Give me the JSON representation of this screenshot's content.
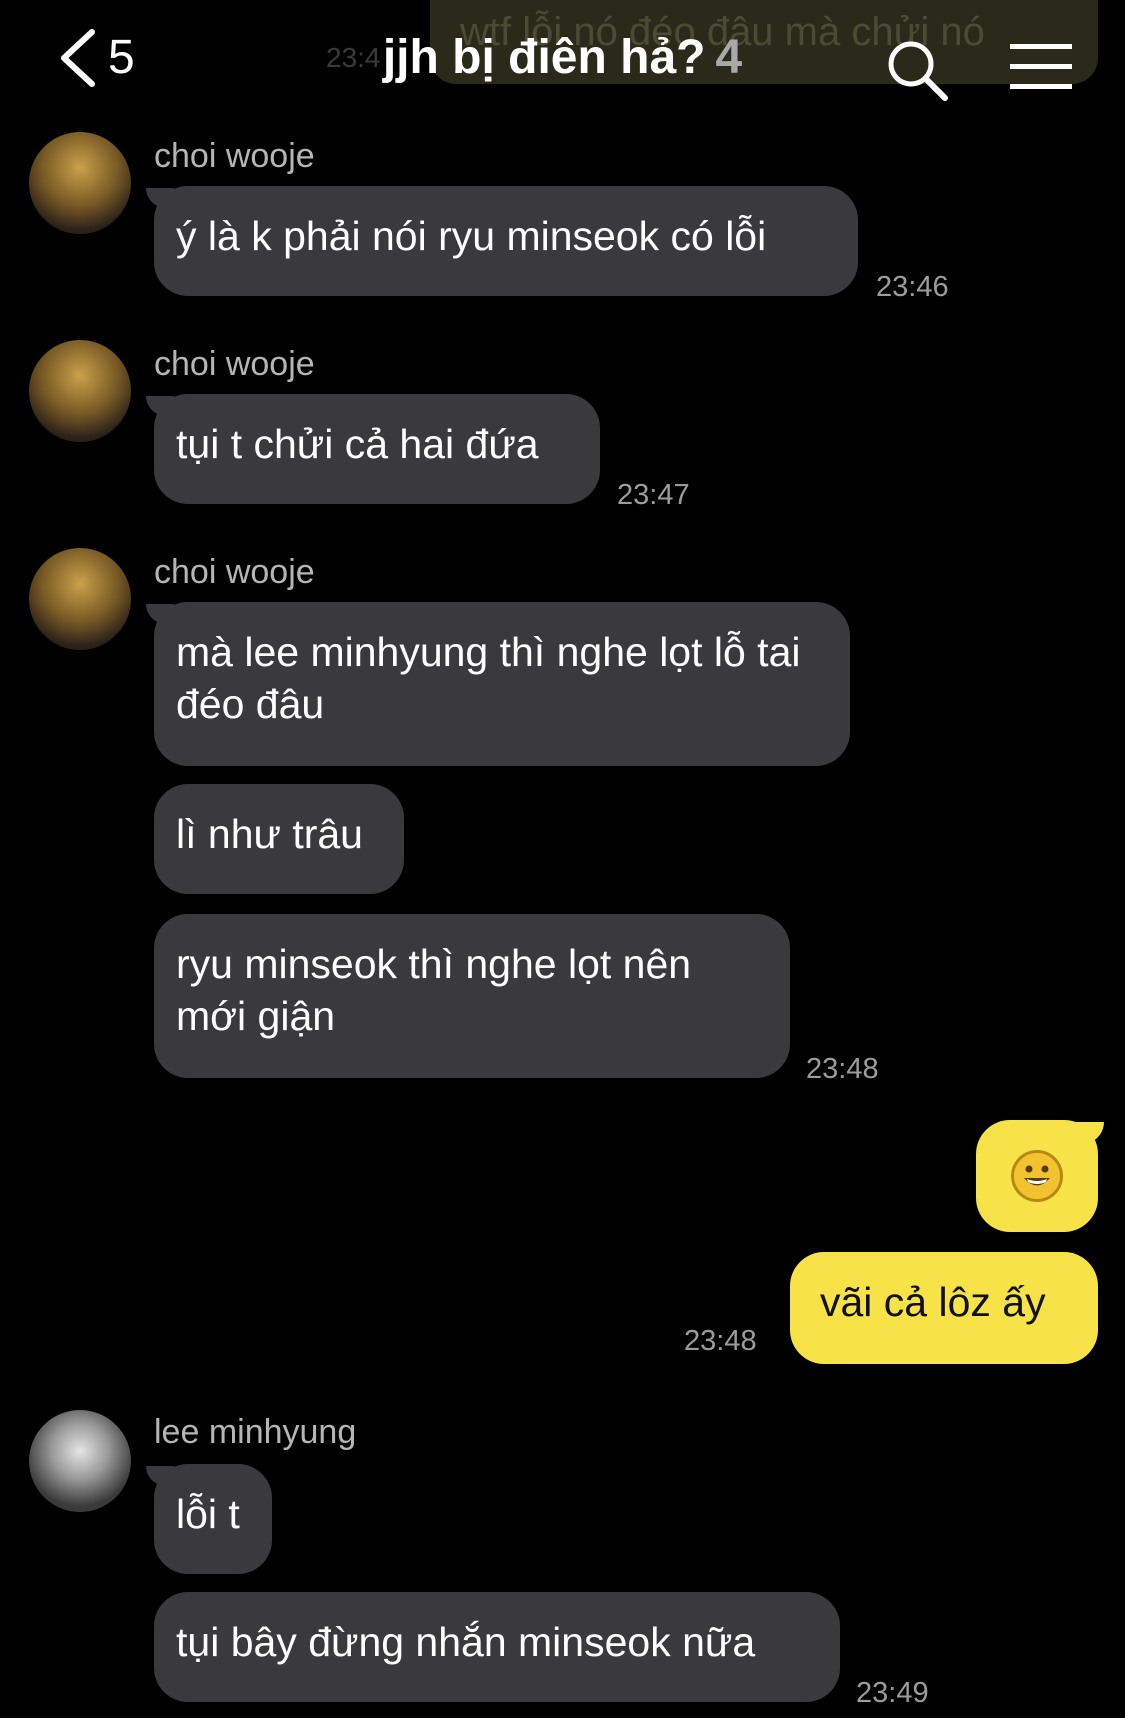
{
  "header": {
    "back_count": "5",
    "title": "jjh bị điên hả?",
    "member_count": "4"
  },
  "ghost": {
    "text": "wtf lỗi nó đéo đâu mà chửi nó",
    "time": "23:4"
  },
  "messages": [
    {
      "sender": "choi wooje",
      "text": "ý là k phải nói ryu minseok có lỗi",
      "time": "23:46"
    },
    {
      "sender": "choi wooje",
      "text": "tụi t chửi cả hai đứa",
      "time": "23:47"
    },
    {
      "sender": "choi wooje",
      "text": "mà lee minhyung thì nghe lọt lỗ tai đéo đâu"
    },
    {
      "text": "lì như trâu"
    },
    {
      "text": "ryu minseok thì nghe lọt nên mới giận",
      "time": "23:48"
    },
    {
      "emoji": "grinning-face"
    },
    {
      "text": "vãi cả lôz ấy",
      "time": "23:48"
    },
    {
      "sender": "lee minhyung",
      "text": "lỗi t"
    },
    {
      "text": "tụi bây đừng nhắn minseok nữa",
      "time": "23:49"
    }
  ],
  "colors": {
    "background": "#000000",
    "bubble_other": "#3a3a3c",
    "bubble_me": "#f7e348",
    "timestamp": "#9c9c9c"
  },
  "icons": [
    "chevron-left-icon",
    "search-icon",
    "menu-icon"
  ]
}
